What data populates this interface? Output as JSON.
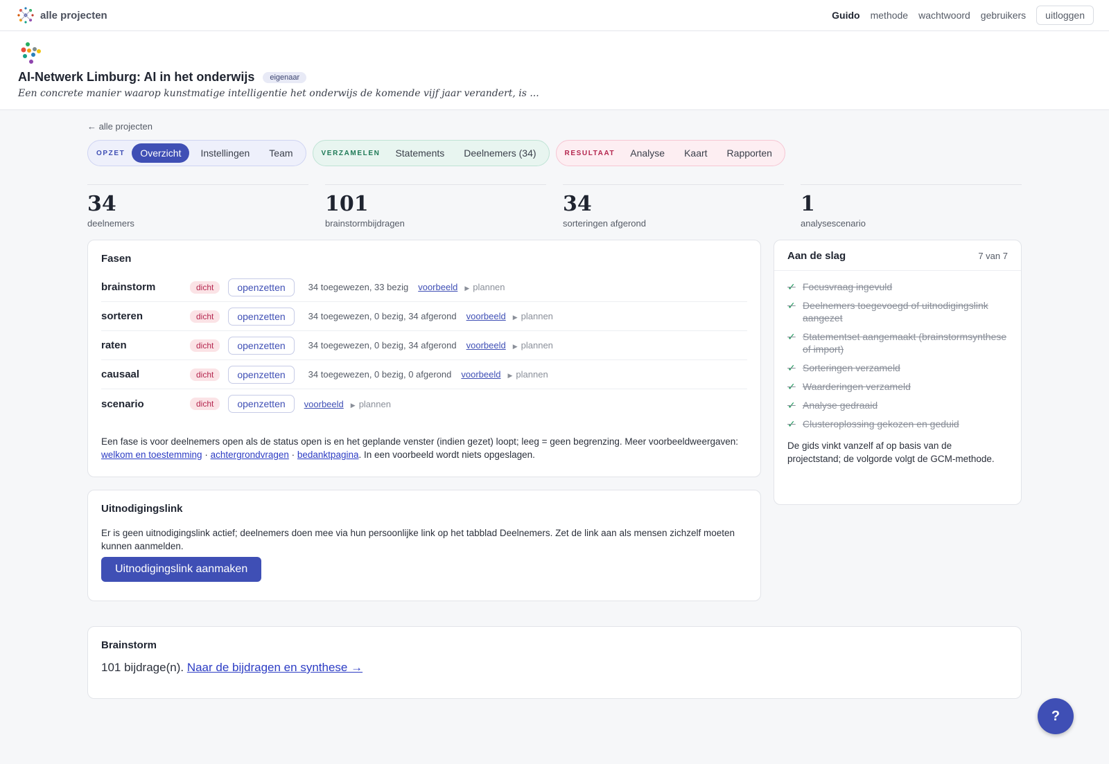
{
  "app": {
    "brand_label": "alle projecten"
  },
  "nav": {
    "user": "Guido",
    "methode": "methode",
    "wachtwoord": "wachtwoord",
    "gebruikers": "gebruikers",
    "logout": "uitloggen"
  },
  "project": {
    "title": "AI-Netwerk Limburg: AI in het onderwijs",
    "role_badge": "eigenaar",
    "focus": "Een concrete manier waarop kunstmatige intelligentie het onderwijs de komende vijf jaar verandert, is ..."
  },
  "back_link": "← alle projecten",
  "tabgroups": [
    {
      "label": "OPZET",
      "tabs": [
        "Overzicht",
        "Instellingen",
        "Team"
      ],
      "active": "Overzicht"
    },
    {
      "label": "VERZAMELEN",
      "tabs": [
        "Statements",
        "Deelnemers (34)"
      ]
    },
    {
      "label": "RESULTAAT",
      "tabs": [
        "Analyse",
        "Kaart",
        "Rapporten"
      ]
    }
  ],
  "stats": [
    {
      "value": "34",
      "label": "deelnemers"
    },
    {
      "value": "101",
      "label": "brainstormbijdragen"
    },
    {
      "value": "34",
      "label": "sorteringen afgerond"
    },
    {
      "value": "1",
      "label": "analysescenario"
    }
  ],
  "fasen": {
    "title": "Fasen",
    "status_label": "dicht",
    "open_label": "openzetten",
    "preview_label": "voorbeeld",
    "plan_label": "plannen",
    "phases": [
      {
        "name": "brainstorm",
        "status_text": "34 toegewezen, 33 bezig"
      },
      {
        "name": "sorteren",
        "status_text": "34 toegewezen, 0 bezig, 34 afgerond"
      },
      {
        "name": "raten",
        "status_text": "34 toegewezen, 0 bezig, 34 afgerond"
      },
      {
        "name": "causaal",
        "status_text": "34 toegewezen, 0 bezig, 0 afgerond"
      },
      {
        "name": "scenario",
        "status_text": ""
      }
    ],
    "note_pre": "Een fase is voor deelnemers open als de status open is en het geplande venster (indien gezet) loopt; leeg = geen begrenzing. Meer voorbeeldweergaven: ",
    "link_welkom": "welkom en toestemming",
    "sep": " · ",
    "link_achtergrond": "achtergrondvragen",
    "link_bedankt": "bedanktpagina",
    "note_post": ". In een voorbeeld wordt niets opgeslagen."
  },
  "uitnodiging": {
    "title": "Uitnodigingslink",
    "text": "Er is geen uitnodigingslink actief; deelnemers doen mee via hun persoonlijke link op het tabblad Deelnemers. Zet de link aan als mensen zichzelf moeten kunnen aanmelden.",
    "button": "Uitnodigingslink aanmaken"
  },
  "aan_de_slag": {
    "title": "Aan de slag",
    "count": "7 van 7",
    "items": [
      "Focusvraag ingevuld",
      "Deelnemers toegevoegd of uitnodigingslink aangezet",
      "Statementset aangemaakt (brainstormsynthese of import)",
      "Sorteringen verzameld",
      "Waarderingen verzameld",
      "Analyse gedraaid",
      "Clusteroplossing gekozen en geduid"
    ],
    "note": "De gids vinkt vanzelf af op basis van de projectstand; de volgorde volgt de GCM-methode."
  },
  "brainstorm": {
    "title": "Brainstorm",
    "count_text": "101 bijdrage(n).",
    "link": "Naar de bijdragen en synthese →"
  },
  "help": "?",
  "colors": {
    "accent": "#3f4fb5",
    "green": "#1f7a57",
    "red": "#b4264e"
  }
}
